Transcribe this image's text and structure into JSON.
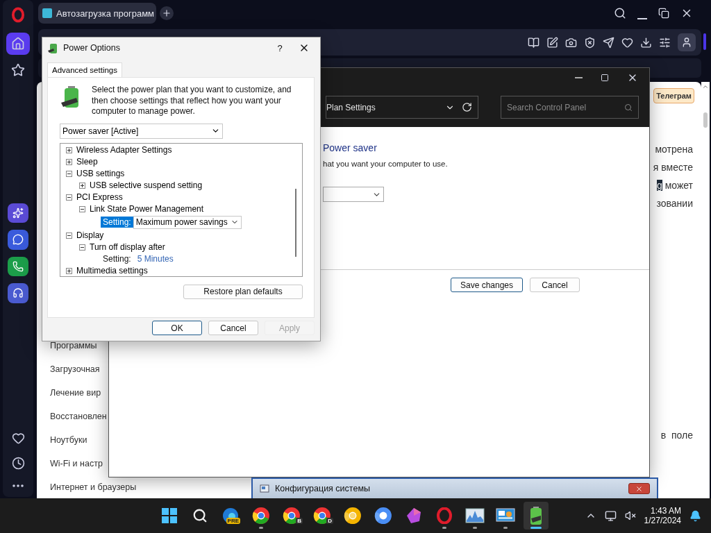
{
  "browser": {
    "tab": {
      "title": "Автозагрузка программ"
    },
    "nav_links": [
      "Программы",
      "Загрузочная",
      "Лечение вир",
      "Восстановлен",
      "Ноутбуки",
      "Wi-Fi и настр",
      "Интернет и браузеры"
    ],
    "telegram_button": "Телеграм",
    "article_lines": [
      {
        "text": "мотрена"
      },
      {
        "text": "я вместе"
      },
      {
        "highlight": "g",
        "text": "может"
      },
      {
        "text": "зовании"
      },
      {
        "text": "в  поле"
      }
    ]
  },
  "control_panel": {
    "address": "Plan Settings",
    "search": {
      "placeholder": "Search Control Panel"
    },
    "heading": "Power saver",
    "subtitle": "hat you want your computer to use.",
    "buttons": [
      "Save changes",
      "Cancel"
    ]
  },
  "power_options": {
    "title": "Power Options",
    "help": "?",
    "tabs": [
      {
        "label": "Advanced settings",
        "selected": true
      }
    ],
    "description": "Select the power plan that you want to customize, and then choose settings that reflect how you want your computer to manage power.",
    "plan": "Power saver [Active]",
    "tree": [
      {
        "kind": "group",
        "label": "Wireless Adapter Settings",
        "expanded": false
      },
      {
        "kind": "group",
        "label": "Sleep",
        "expanded": false
      },
      {
        "kind": "group",
        "label": "USB settings",
        "expanded": true,
        "children": [
          {
            "kind": "group",
            "label": "USB selective suspend setting",
            "expanded": false
          }
        ]
      },
      {
        "kind": "group",
        "label": "PCI Express",
        "expanded": true,
        "children": [
          {
            "kind": "group",
            "label": "Link State Power Management",
            "expanded": true,
            "children": [
              {
                "kind": "setting",
                "label": "Setting:",
                "value": "Maximum power savings",
                "selected": true
              }
            ]
          }
        ]
      },
      {
        "kind": "group",
        "label": "Display",
        "expanded": true,
        "children": [
          {
            "kind": "group",
            "label": "Turn off display after",
            "expanded": true,
            "children": [
              {
                "kind": "setting",
                "label": "Setting:",
                "value": "5 Minutes",
                "selected": false
              }
            ]
          }
        ]
      },
      {
        "kind": "group",
        "label": "Multimedia settings",
        "expanded": false
      }
    ],
    "restore_button": "Restore plan defaults",
    "buttons": [
      {
        "label": "OK",
        "disabled": false
      },
      {
        "label": "Cancel",
        "disabled": false
      },
      {
        "label": "Apply",
        "disabled": true
      }
    ]
  },
  "background_window": {
    "title": "Конфигурация системы"
  },
  "taskbar": {
    "apps": [
      {
        "kind": "start",
        "running": false,
        "active": false
      },
      {
        "kind": "search",
        "running": false,
        "active": false
      },
      {
        "kind": "edge",
        "badge": "PRE",
        "running": false,
        "active": false
      },
      {
        "kind": "chrome",
        "running": true,
        "active": false
      },
      {
        "kind": "chrome",
        "badge": "B",
        "running": false,
        "active": false
      },
      {
        "kind": "chrome",
        "badge": "D",
        "running": false,
        "active": false
      },
      {
        "kind": "canary",
        "running": false,
        "active": false
      },
      {
        "kind": "chromium",
        "running": false,
        "active": false
      },
      {
        "kind": "polygon",
        "running": false,
        "active": false
      },
      {
        "kind": "opera",
        "running": true,
        "active": false
      },
      {
        "kind": "monitor",
        "running": true,
        "active": false
      },
      {
        "kind": "panel",
        "running": true,
        "active": false
      },
      {
        "kind": "battery",
        "running": true,
        "active": true
      }
    ],
    "time": "1:43 AM",
    "date": "1/27/2024"
  }
}
